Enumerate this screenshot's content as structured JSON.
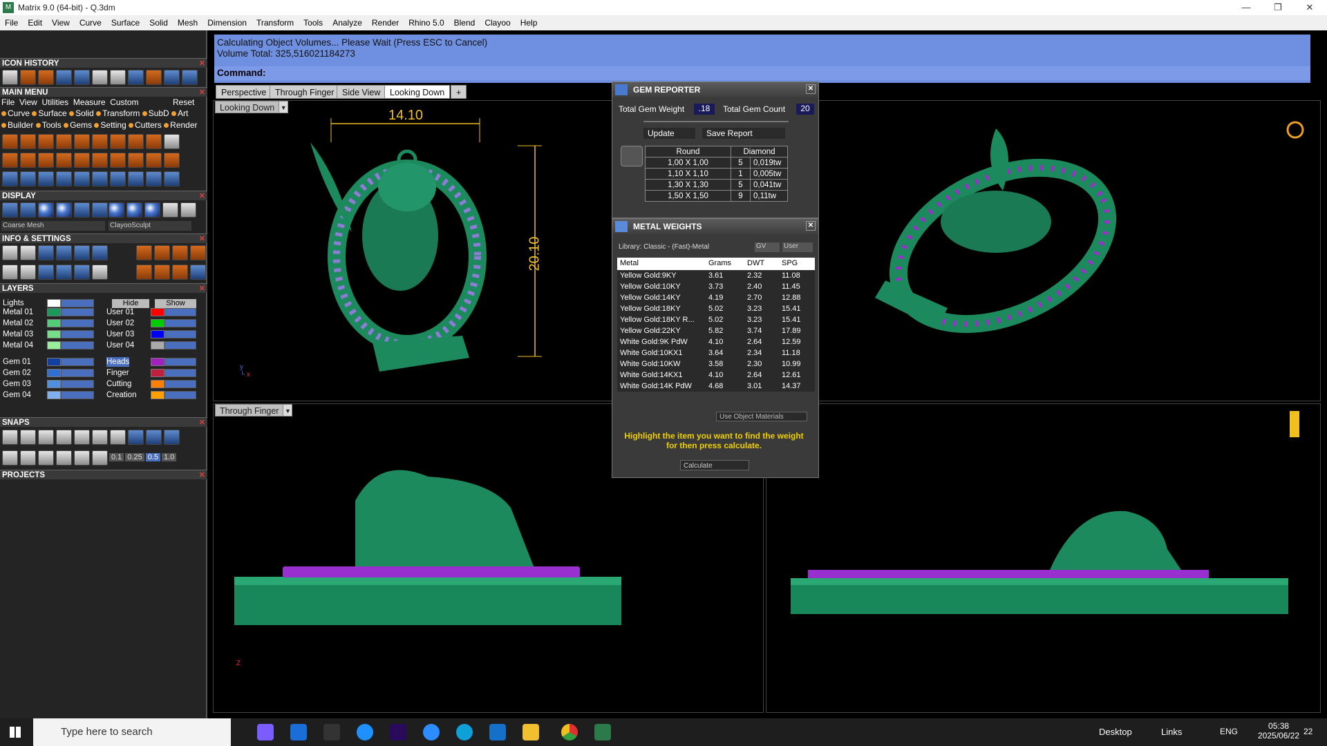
{
  "window": {
    "title": "Matrix 9.0 (64-bit) - Q.3dm"
  },
  "menu": [
    "File",
    "Edit",
    "View",
    "Curve",
    "Surface",
    "Solid",
    "Mesh",
    "Dimension",
    "Transform",
    "Tools",
    "Analyze",
    "Render",
    "Rhino 5.0",
    "Blend",
    "Clayoo",
    "Help"
  ],
  "command": {
    "line1": "Calculating Object Volumes... Please Wait (Press ESC to Cancel)",
    "line2": "Volume Total: 325,516021184273",
    "label": "Command:"
  },
  "panels": {
    "icon_history": "ICON HISTORY",
    "main_menu": "MAIN MENU",
    "main_menu_row1": [
      "File",
      "View",
      "Utilities",
      "Measure",
      "Custom"
    ],
    "reset": "Reset",
    "cats1": [
      "Curve",
      "Surface",
      "Solid",
      "Transform",
      "SubD",
      "Art"
    ],
    "cats2": [
      "Builder",
      "Tools",
      "Gems",
      "Setting",
      "Cutters",
      "Render"
    ],
    "display": "DISPLAY",
    "coarse_mesh": "Coarse Mesh",
    "clayoo_sculpt": "ClayooSculpt",
    "info_settings": "INFO & SETTINGS",
    "layers": "LAYERS",
    "lights": "Lights",
    "hide": "Hide",
    "show": "Show",
    "layers_left": [
      "Metal 01",
      "Metal 02",
      "Metal 03",
      "Metal 04",
      "Gem 01",
      "Gem 02",
      "Gem 03",
      "Gem 04"
    ],
    "layers_right": [
      "User 01",
      "User 02",
      "User 03",
      "User 04",
      "Heads",
      "Finger",
      "Cutting",
      "Creation"
    ],
    "layer_colors_right": [
      "#ff0000",
      "#00cc00",
      "#0000ff",
      "#aaaaaa",
      "#a020c0",
      "#c02040",
      "#ff8000",
      "#ffa000"
    ],
    "layer_colors_left": [
      "#1a9a5a",
      "#55cc77",
      "#77dd88",
      "#99ee99",
      "#1040a0",
      "#3070d0",
      "#5090e0",
      "#80b0f0"
    ],
    "snaps": "SNAPS",
    "snap_values": [
      "0.1",
      "0.25",
      "0.5",
      "1.0"
    ],
    "projects": "PROJECTS"
  },
  "tabs": [
    "Perspective",
    "Through Finger",
    "Side View",
    "Looking Down"
  ],
  "viewports": {
    "top_left": "Looking Down",
    "bottom_left": "Through Finger"
  },
  "dims": {
    "width": "14.10",
    "height": "20.10"
  },
  "gem_reporter": {
    "title": "GEM REPORTER",
    "total_weight_label": "Total Gem Weight",
    "total_weight": ".18",
    "total_count_label": "Total Gem Count",
    "total_count": "20",
    "update": "Update",
    "save_report": "Save Report",
    "cut": "Round",
    "stone": "Diamond",
    "rows": [
      [
        "1,00 X 1,00",
        "5",
        "0,019tw"
      ],
      [
        "1,10 X 1,10",
        "1",
        "0,005tw"
      ],
      [
        "1,30 X 1,30",
        "5",
        "0,041tw"
      ],
      [
        "1,50 X 1,50",
        "9",
        "0,11tw"
      ]
    ]
  },
  "metal_weights": {
    "title": "METAL WEIGHTS",
    "library": "Library: Classic - (Fast)-Metal",
    "gv": "GV",
    "user": "User",
    "headers": [
      "Metal",
      "Grams",
      "DWT",
      "SPG"
    ],
    "rows": [
      [
        "Yellow Gold:9KY",
        "3.61",
        "2.32",
        "11.08"
      ],
      [
        "Yellow Gold:10KY",
        "3.73",
        "2.40",
        "11.45"
      ],
      [
        "Yellow Gold:14KY",
        "4.19",
        "2.70",
        "12.88"
      ],
      [
        "Yellow Gold:18KY",
        "5.02",
        "3.23",
        "15.41"
      ],
      [
        "Yellow Gold:18KY R...",
        "5.02",
        "3.23",
        "15.41"
      ],
      [
        "Yellow Gold:22KY",
        "5.82",
        "3.74",
        "17.89"
      ],
      [
        "White Gold:9K PdW",
        "4.10",
        "2.64",
        "12.59"
      ],
      [
        "White Gold:10KX1",
        "3.64",
        "2.34",
        "11.18"
      ],
      [
        "White Gold:10KW",
        "3.58",
        "2.30",
        "10.99"
      ],
      [
        "White Gold:14KX1",
        "4.10",
        "2.64",
        "12.61"
      ],
      [
        "White Gold:14K PdW",
        "4.68",
        "3.01",
        "14.37"
      ]
    ],
    "use_object_materials": "Use Object Materials",
    "hint": "Highlight the item you want to find the weight for then press calculate.",
    "calculate": "Calculate"
  },
  "taskbar": {
    "search": "Type here to search",
    "desktop": "Desktop",
    "links": "Links",
    "lang": "ENG",
    "time": "05:38",
    "date": "2025/06/22",
    "notif": "22"
  },
  "colors": {
    "model": "#1d8a5e",
    "gems": "#8f7bd8",
    "prongs": "#a02ccf",
    "dim": "#f0c020",
    "cmd": "#6f8fe0"
  }
}
